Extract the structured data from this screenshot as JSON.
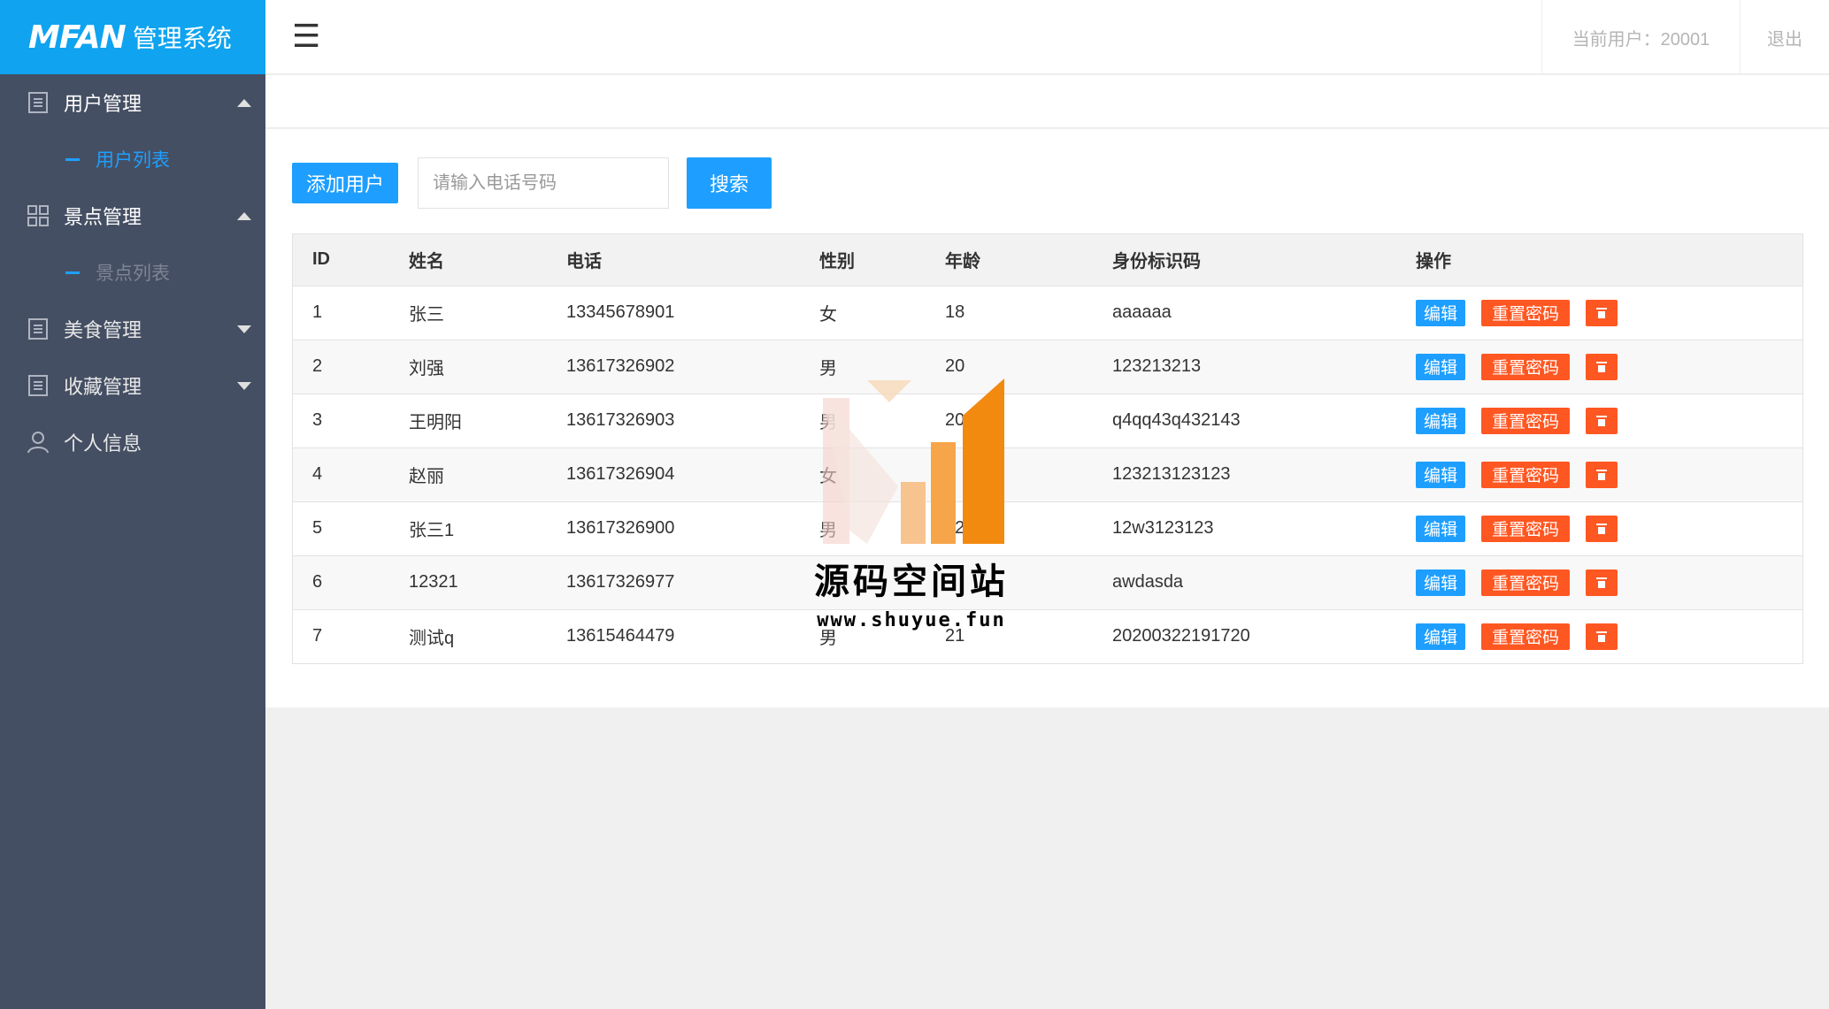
{
  "app": {
    "logo_mark": "MFAN",
    "logo_text": "管理系统"
  },
  "sidebar": {
    "groups": [
      {
        "label": "用户管理",
        "icon": "list-icon",
        "expanded": true,
        "children": [
          {
            "label": "用户列表",
            "state": "active"
          }
        ]
      },
      {
        "label": "景点管理",
        "icon": "grid-icon",
        "expanded": true,
        "children": [
          {
            "label": "景点列表",
            "state": "inactive"
          }
        ]
      },
      {
        "label": "美食管理",
        "icon": "list-icon",
        "expanded": false
      },
      {
        "label": "收藏管理",
        "icon": "list-icon",
        "expanded": false
      },
      {
        "label": "个人信息",
        "icon": "user-icon",
        "expanded": false
      }
    ]
  },
  "header": {
    "current_user": "当前用户：20001",
    "logout": "退出"
  },
  "toolbar": {
    "add_label": "添加用户",
    "search_placeholder": "请输入电话号码",
    "search_value": "",
    "search_label": "搜索"
  },
  "table": {
    "columns": [
      "ID",
      "姓名",
      "电话",
      "性别",
      "年龄",
      "身份标识码",
      "操作"
    ],
    "actions": {
      "edit": "编辑",
      "reset": "重置密码",
      "delete_icon": "trash-icon"
    },
    "rows": [
      {
        "id": "1",
        "name": "张三",
        "phone": "13345678901",
        "gender": "女",
        "age": "18",
        "ident": "aaaaaa"
      },
      {
        "id": "2",
        "name": "刘强",
        "phone": "13617326902",
        "gender": "男",
        "age": "20",
        "ident": "123213213"
      },
      {
        "id": "3",
        "name": "王明阳",
        "phone": "13617326903",
        "gender": "男",
        "age": "20",
        "ident": "q4qq43q432143"
      },
      {
        "id": "4",
        "name": "赵丽",
        "phone": "13617326904",
        "gender": "女",
        "age": "",
        "ident": "123213123123"
      },
      {
        "id": "5",
        "name": "张三1",
        "phone": "13617326900",
        "gender": "男",
        "age": "123123",
        "ident": "12w3123123"
      },
      {
        "id": "6",
        "name": "12321",
        "phone": "13617326977",
        "gender": "",
        "age": "",
        "ident": "awdasda"
      },
      {
        "id": "7",
        "name": "测试q",
        "phone": "13615464479",
        "gender": "男",
        "age": "21",
        "ident": "20200322191720"
      }
    ]
  },
  "watermark": {
    "title": "源码空间站",
    "url": "www.shuyue.fun"
  },
  "colors": {
    "primary": "#1e9fff",
    "danger": "#ff5722",
    "sidebar_bg": "#454f63",
    "logo_bg": "#0fa3f0"
  }
}
